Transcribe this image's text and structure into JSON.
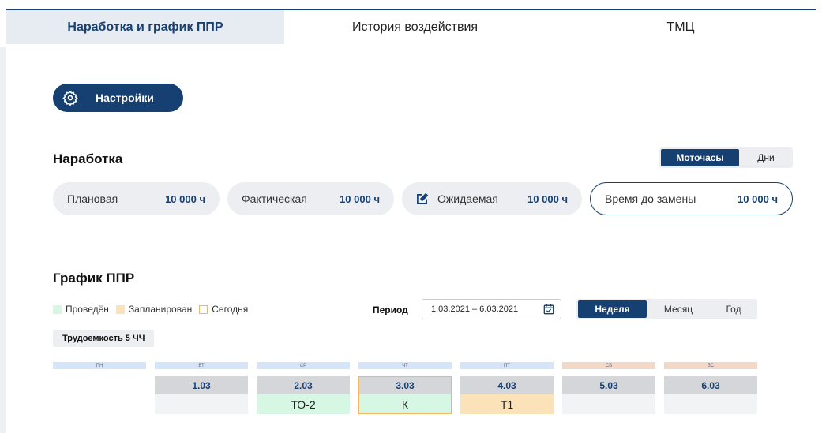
{
  "tabs": [
    {
      "label": "Наработка и график ППР",
      "active": true
    },
    {
      "label": "История воздействия",
      "active": false
    },
    {
      "label": "ТМЦ",
      "active": false
    }
  ],
  "settings": {
    "label": "Настройки",
    "icon": "gear-icon"
  },
  "runtime": {
    "title": "Наработка",
    "units": [
      "Моточасы",
      "Дни"
    ],
    "units_selected": "Моточасы",
    "metrics": [
      {
        "label": "Плановая",
        "value": "10 000 ч"
      },
      {
        "label": "Фактическая",
        "value": "10 000 ч"
      },
      {
        "label": "Ожидаемая",
        "value": "10 000 ч",
        "icon": "edit-icon"
      },
      {
        "label": "Время до замены",
        "value": "10 000 ч"
      }
    ]
  },
  "schedule": {
    "title": "График ППР",
    "legend": [
      {
        "label": "Проведён",
        "color": "#d5f7e3"
      },
      {
        "label": "Запланирован",
        "color": "#fbe2b8"
      },
      {
        "label": "Сегодня",
        "color": "#f0b661"
      }
    ],
    "period_label": "Период",
    "period_value": "1.03.2021 – 6.03.2021",
    "ranges": [
      "Неделя",
      "Месяц",
      "Год"
    ],
    "range_selected": "Неделя",
    "labor": "Трудоемкость 5 ЧЧ",
    "days": [
      {
        "name": "ПН",
        "date": "",
        "work": "",
        "status": "none"
      },
      {
        "name": "ВТ",
        "date": "1.03",
        "work": "",
        "status": "none"
      },
      {
        "name": "СР",
        "date": "2.03",
        "work": "ТО-2",
        "status": "done"
      },
      {
        "name": "ЧТ",
        "date": "3.03",
        "work": "К",
        "status": "done"
      },
      {
        "name": "ПТ",
        "date": "4.03",
        "work": "Т1",
        "status": "planned"
      },
      {
        "name": "СБ",
        "date": "5.03",
        "work": "",
        "status": "none"
      },
      {
        "name": "ВС",
        "date": "6.03",
        "work": "",
        "status": "none"
      }
    ],
    "today": "3.03"
  },
  "colors": {
    "primary": "#163f72",
    "done": "#d5f7e3",
    "planned": "#fbe2b8",
    "today": "#f0b661",
    "weekday": "#d6e4f7",
    "weekend": "#f2d8c9"
  }
}
